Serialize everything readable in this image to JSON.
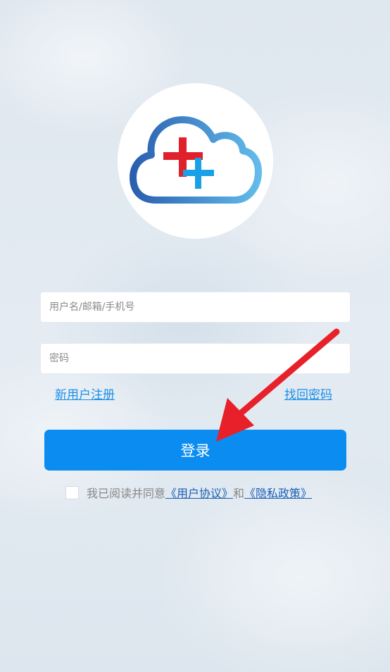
{
  "logo": {
    "icon": "cloud-medical-cross-icon",
    "colors": {
      "cloud_dark": "#2a5fb0",
      "cloud_light": "#5fb8e8",
      "cross_red": "#e0202a",
      "cross_blue": "#1aa0e6"
    }
  },
  "login_form": {
    "username_placeholder": "用户名/邮箱/手机号",
    "username_value": "",
    "password_placeholder": "密码",
    "password_value": "",
    "register_label": "新用户注册",
    "forgot_label": "找回密码",
    "login_label": "登录"
  },
  "agreement": {
    "checked": false,
    "prefix_text": "我已阅读并同意",
    "user_agreement_label": "《用户协议》",
    "and_text": "和",
    "privacy_policy_label": "《隐私政策》"
  },
  "theme": {
    "primary": "#0a8cf0",
    "link": "#1a8fe8",
    "annotation_arrow": "#e8202a"
  }
}
